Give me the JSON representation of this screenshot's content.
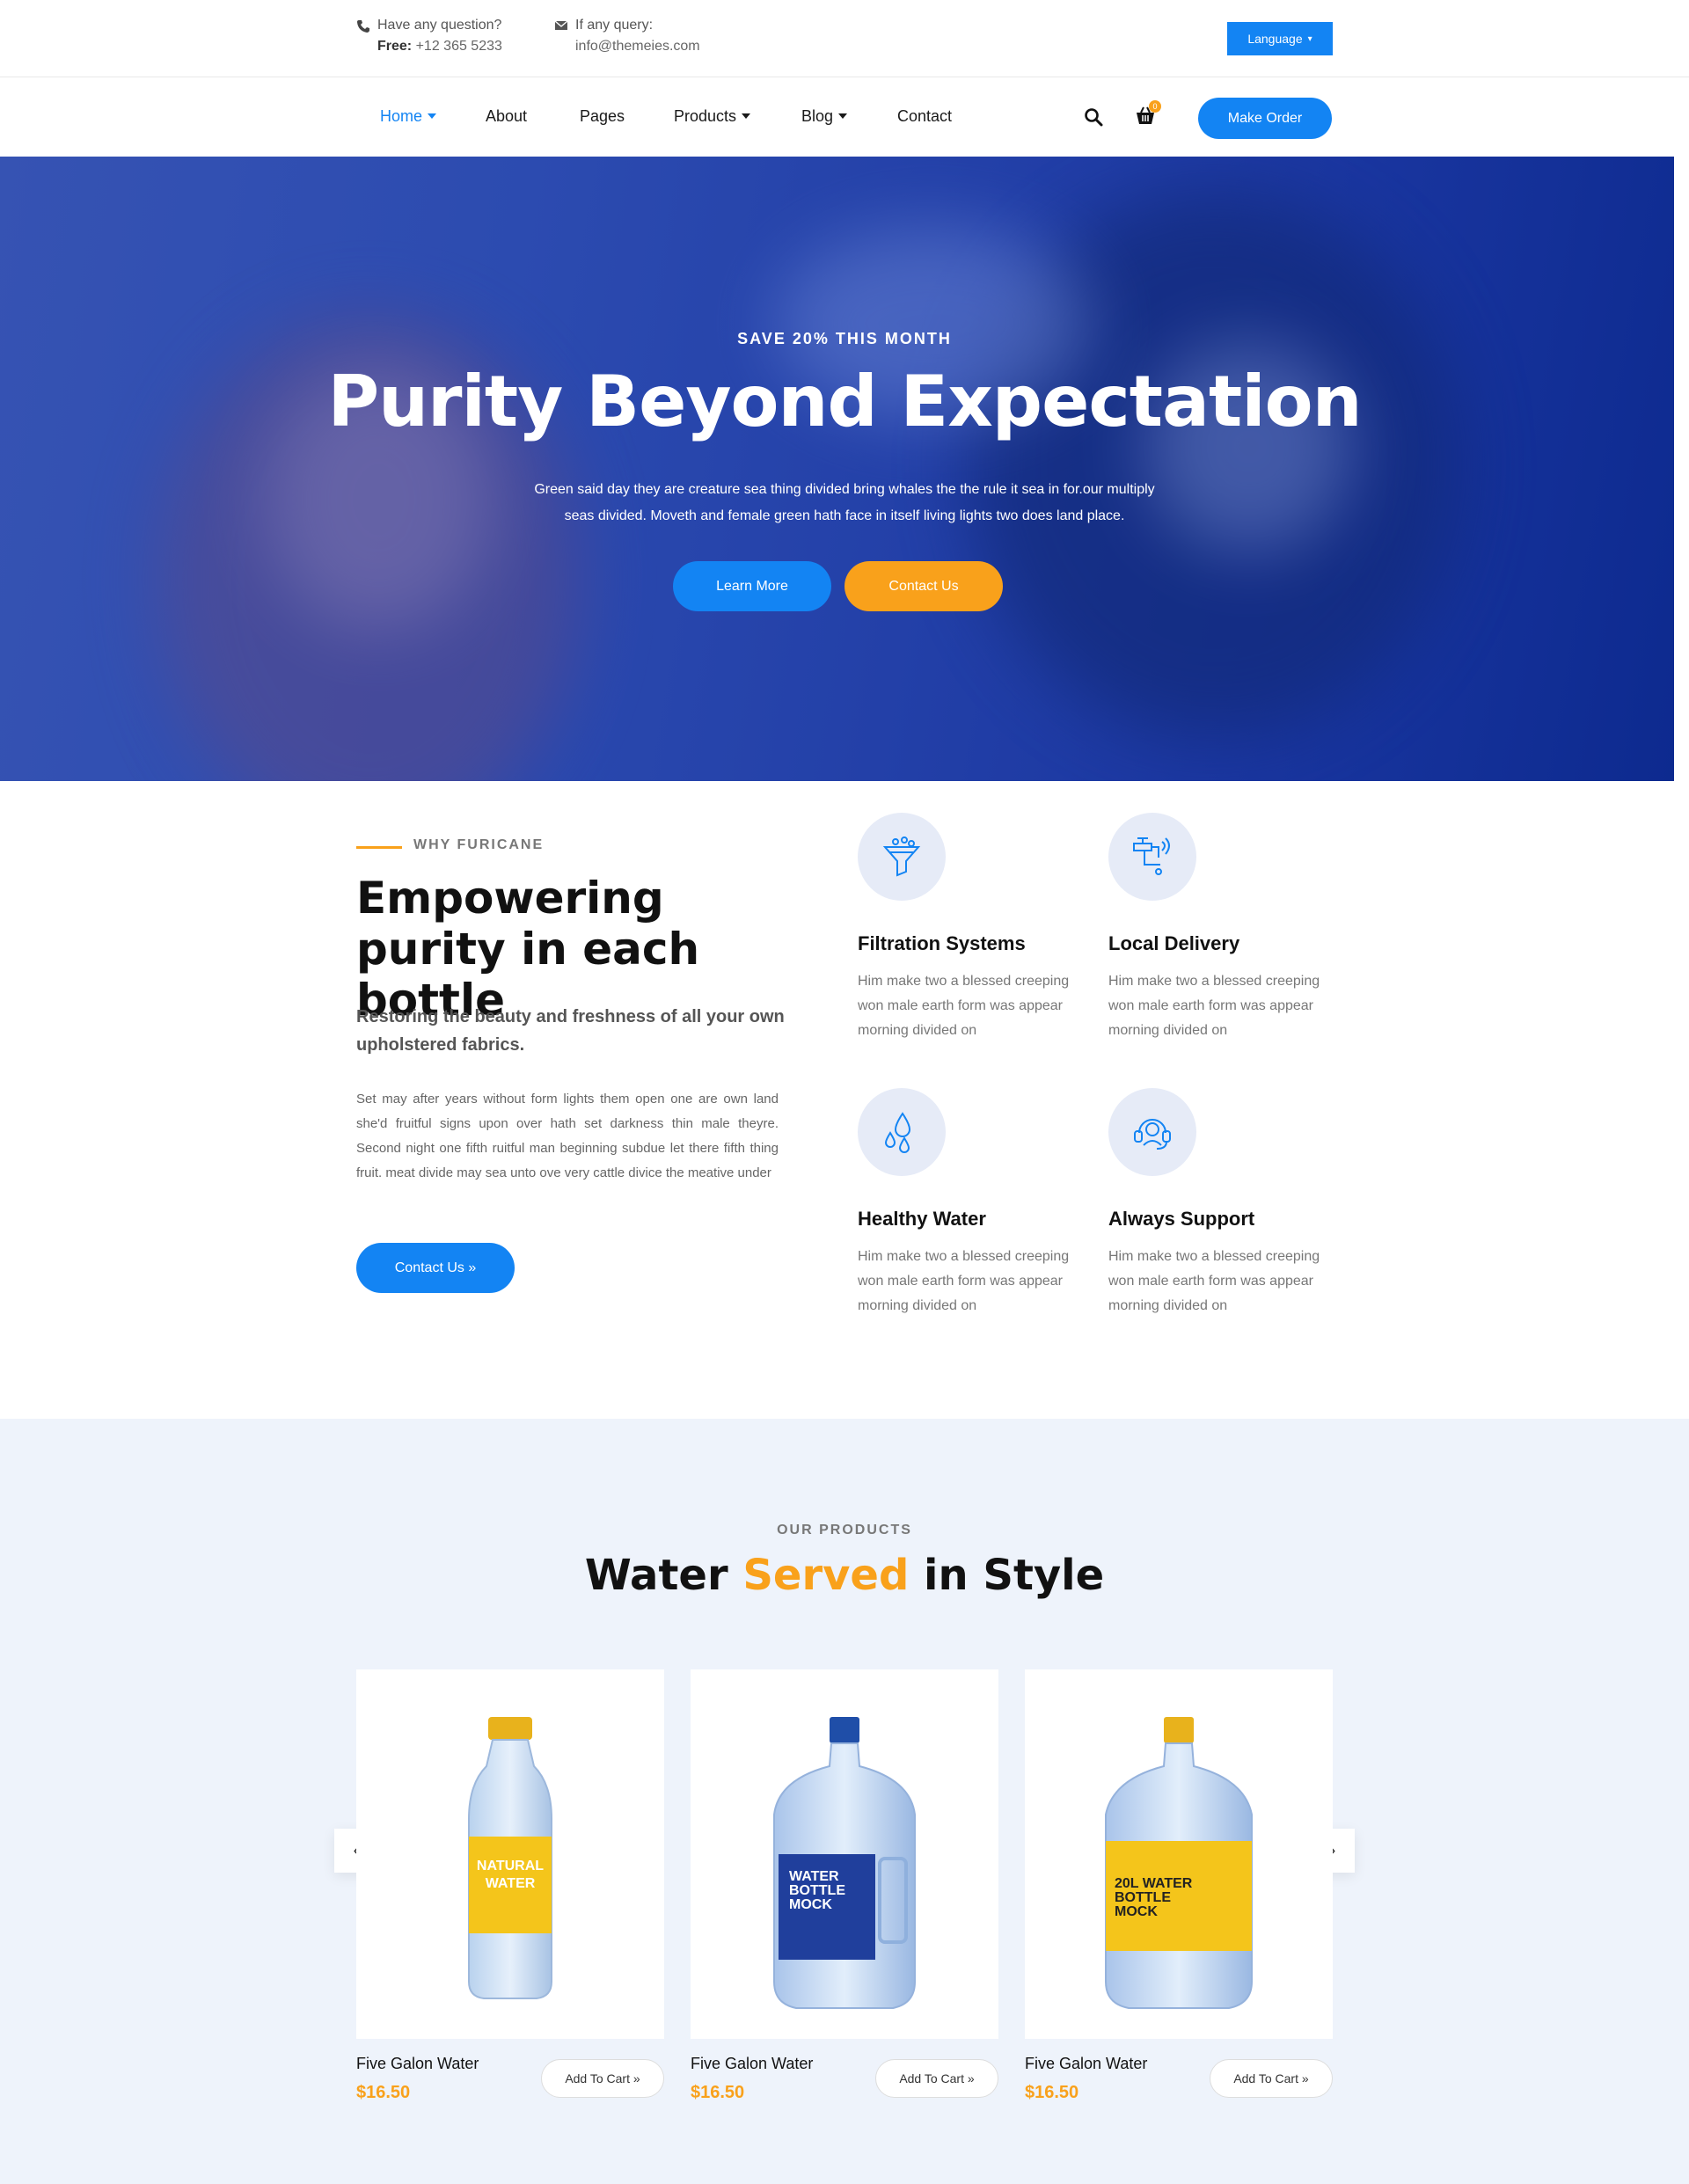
{
  "topbar": {
    "question_label": "Have any question?",
    "phone_prefix": "Free:",
    "phone": "+12 365 5233",
    "query_label": "If any query:",
    "email": "info@themeies.com",
    "language_label": "Language"
  },
  "nav": {
    "items": [
      "Home",
      "About",
      "Pages",
      "Products",
      "Blog",
      "Contact"
    ],
    "cart_count": "0",
    "make_order_label": "Make Order"
  },
  "hero": {
    "eyebrow": "SAVE 20% THIS MONTH",
    "title": "Purity Beyond Expectation",
    "text": "Green said day they are creature sea thing divided bring whales the the rule it sea in for.our multiply seas divided. Moveth and female green hath face in itself living lights two does land place.",
    "learn_more_label": "Learn More",
    "contact_label": "Contact Us"
  },
  "why": {
    "eyebrow": "WHY FURICANE",
    "title": "Empowering purity in each bottle",
    "lead": "Restoring the beauty and freshness of all your own upholstered fabrics.",
    "body": "Set may after years without form lights them open one are own land she'd fruitful signs upon over hath set darkness thin male theyre. Second night one fifth ruitful man beginning subdue let there fifth thing fruit. meat divide may sea unto ove very cattle divice the meative under",
    "contact_label": "Contact Us »",
    "features": [
      {
        "title": "Filtration Systems",
        "text": "Him make two a blessed creeping won male earth form was appear morning divided on",
        "icon": "filter-icon"
      },
      {
        "title": "Local Delivery",
        "text": "Him make two a blessed creeping won male earth form was appear morning divided on",
        "icon": "tap-icon"
      },
      {
        "title": "Healthy Water",
        "text": "Him make two a blessed creeping won male earth form was appear morning divided on",
        "icon": "water-drops-icon"
      },
      {
        "title": "Always Support",
        "text": "Him make two a blessed creeping won male earth form was appear morning divided on",
        "icon": "headset-icon"
      }
    ]
  },
  "products": {
    "eyebrow": "OUR PRODUCTS",
    "title_part1": "Water ",
    "title_accent": "Served",
    "title_part2": " in Style",
    "add_to_cart_label": "Add To Cart »",
    "items": [
      {
        "name": "Five Galon Water",
        "price": "$16.50",
        "label_lines": [
          "NATURAL",
          "WATER"
        ]
      },
      {
        "name": "Five Galon Water",
        "price": "$16.50",
        "label_lines": [
          "WATER",
          "BOTTLE",
          "MOCK"
        ]
      },
      {
        "name": "Five Galon Water",
        "price": "$16.50",
        "label_lines": [
          "20L WATER",
          "BOTTLE",
          "MOCK"
        ]
      }
    ]
  },
  "colors": {
    "primary": "#1384f3",
    "accent": "#f9a11b",
    "hero_blue": "#2340a8",
    "section_bg": "#eef3fb"
  }
}
